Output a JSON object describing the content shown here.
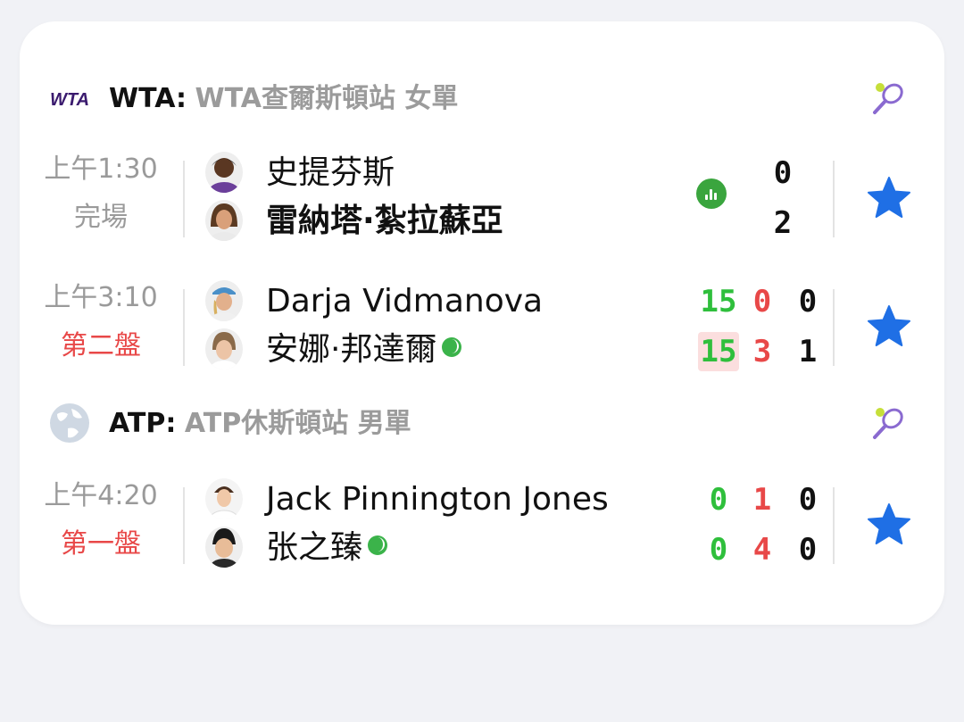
{
  "leagues": [
    {
      "code": "WTA:",
      "name": "WTA查爾斯頓站 女單",
      "logo": "wta-logo",
      "matches": [
        {
          "time": "上午1:30",
          "status": "完場",
          "player1": "史提芬斯",
          "player2": "雷納塔·紮拉蘇亞",
          "scores1": [
            "0"
          ],
          "scores2": [
            "2"
          ]
        },
        {
          "time": "上午3:10",
          "status": "第二盤",
          "player1": "Darja Vidmanova",
          "player2": "安娜·邦達爾",
          "scores1": [
            "15",
            "0",
            "0"
          ],
          "scores2": [
            "15",
            "3",
            "1"
          ]
        }
      ]
    },
    {
      "code": "ATP:",
      "name": "ATP休斯頓站 男單",
      "logo": "globe-icon",
      "matches": [
        {
          "time": "上午4:20",
          "status": "第一盤",
          "player1": "Jack Pinnington Jones",
          "player2": "张之臻",
          "scores1": [
            "0",
            "1",
            "0"
          ],
          "scores2": [
            "0",
            "4",
            "0"
          ]
        }
      ]
    }
  ],
  "colors": {
    "accent_blue": "#1f6fe5",
    "live_red": "#e84848",
    "point_green": "#2fbf3c",
    "serve_green": "#3bb34a",
    "wta_purple": "#3a1a6e"
  },
  "icons": [
    "wta-logo",
    "globe-icon",
    "tennis-racket-icon",
    "star-icon",
    "stats-icon",
    "serving-ball-icon"
  ]
}
